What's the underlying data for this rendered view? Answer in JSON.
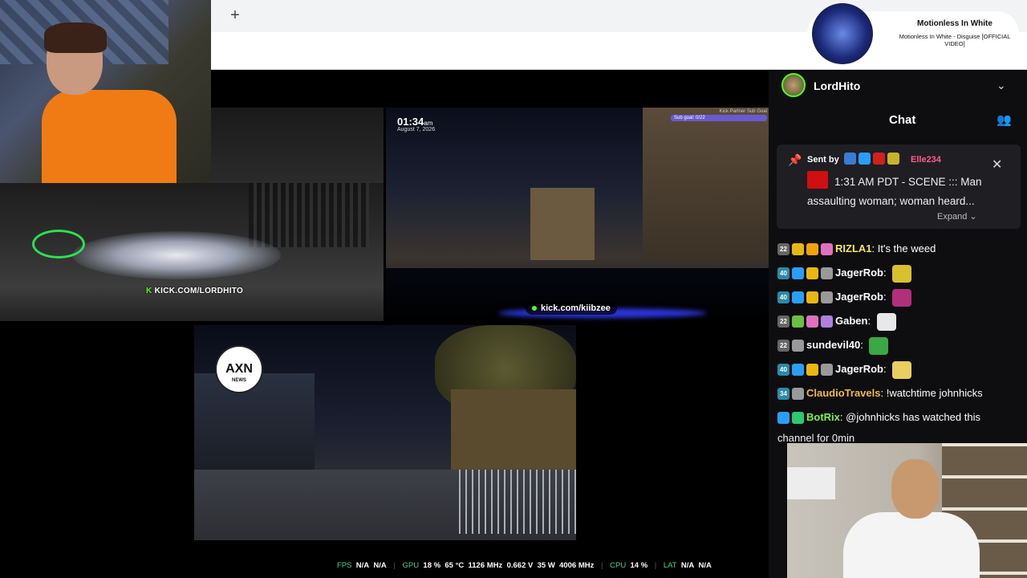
{
  "browser": {
    "new_tab_label": "+"
  },
  "music_player": {
    "artist": "Motionless In White",
    "track": "Motionless In White - Disguise [OFFICIAL VIDEO]"
  },
  "streams": {
    "tile1_watermark_k": "K",
    "tile1_watermark": "KICK.COM/LORDHITO",
    "tile2_time": "01:34",
    "tile2_time_suffix": "am",
    "tile2_date": "August 7, 2026",
    "tile2_subgoal_title": "Kick Partner Sub Goal",
    "tile2_subgoal_text": "Sub goal: 0/22",
    "tile2_watermark": "kick.com/kiibzee",
    "tile3_logo_text": "AXN",
    "tile3_logo_sub": "NEWS"
  },
  "chat": {
    "channel_name": "LordHito",
    "tab_label": "Chat",
    "pinned": {
      "sent_by": "Sent by",
      "user": "Elle234",
      "message": "1:31 AM PDT - SCENE ::: Man assaulting woman; woman heard...",
      "expand_label": "Expand"
    },
    "messages": [
      {
        "badges": [
          "22",
          "crown",
          "1",
          "gift"
        ],
        "user": "RIZLA1",
        "user_color": "#f5e663",
        "text": "It's the weed",
        "emote": ""
      },
      {
        "badges": [
          "40",
          "arrow",
          "crown",
          "skull"
        ],
        "user": "JagerRob",
        "user_color": "#ffffff",
        "text": "",
        "emote": "#d8c02e"
      },
      {
        "badges": [
          "40",
          "arrow",
          "crown",
          "skull"
        ],
        "user": "JagerRob",
        "user_color": "#ffffff",
        "text": "",
        "emote": "#b0307a"
      },
      {
        "badges": [
          "22",
          "alien",
          "gift",
          "mug"
        ],
        "user": "Gaben",
        "user_color": "#ffffff",
        "text": "",
        "emote": "#e8e8e8"
      },
      {
        "badges": [
          "22",
          "skull"
        ],
        "user": "sundevil40",
        "user_color": "#ffffff",
        "text": "",
        "emote": "#3aa845"
      },
      {
        "badges": [
          "40",
          "arrow",
          "crown",
          "skull"
        ],
        "user": "JagerRob",
        "user_color": "#ffffff",
        "text": "",
        "emote": "#e8d060"
      },
      {
        "badges": [
          "34",
          "skull"
        ],
        "user": "ClaudioTravels",
        "user_color": "#f2b84b",
        "text": "!watchtime johnhicks",
        "emote": ""
      },
      {
        "badges": [
          "arrow",
          "check"
        ],
        "user": "BotRix",
        "user_color": "#7cf24b",
        "text": "@johnhicks has watched this",
        "emote": ""
      }
    ],
    "overflow_text": "channel for 0min"
  },
  "stats_bar": {
    "fps_label": "FPS",
    "fps_val1": "N/A",
    "fps_val2": "N/A",
    "gpu_label": "GPU",
    "gpu_load": "18 %",
    "gpu_temp": "65 °C",
    "gpu_clock": "1126 MHz",
    "gpu_volt": "0.662 V",
    "gpu_power": "35 W",
    "gpu_mem": "4006 MHz",
    "cpu_label": "CPU",
    "cpu_load": "14 %",
    "lat_label": "LAT",
    "lat_val1": "N/A",
    "lat_val2": "N/A"
  },
  "colors": {
    "kick_green": "#53fc18",
    "stats_green": "#39d87a",
    "pin_user": "#ff5c8a"
  }
}
